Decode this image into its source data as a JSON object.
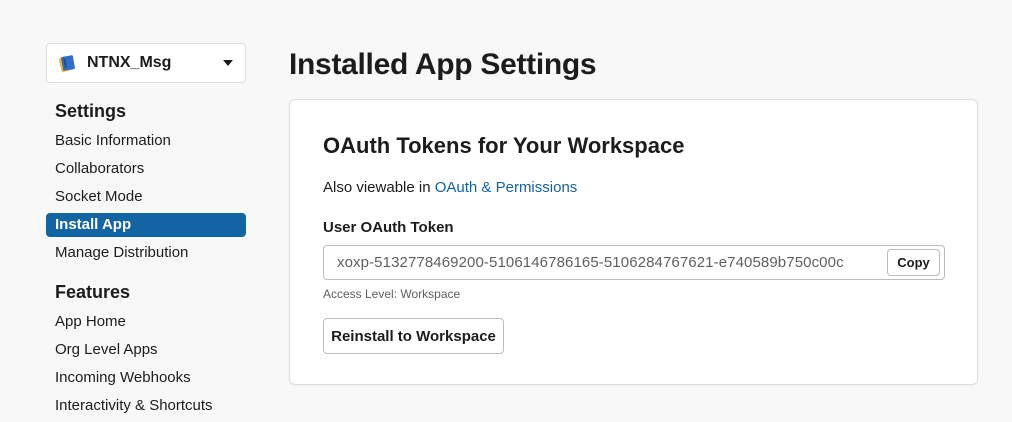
{
  "app_selector": {
    "app_name": "NTNX_Msg",
    "icon": "notebook-icon"
  },
  "sidebar": {
    "settings_heading": "Settings",
    "settings_items": [
      {
        "label": "Basic Information",
        "active": false
      },
      {
        "label": "Collaborators",
        "active": false
      },
      {
        "label": "Socket Mode",
        "active": false
      },
      {
        "label": "Install App",
        "active": true
      },
      {
        "label": "Manage Distribution",
        "active": false
      }
    ],
    "features_heading": "Features",
    "features_items": [
      {
        "label": "App Home"
      },
      {
        "label": "Org Level Apps"
      },
      {
        "label": "Incoming Webhooks"
      },
      {
        "label": "Interactivity & Shortcuts"
      }
    ]
  },
  "main": {
    "page_title": "Installed App Settings",
    "card": {
      "title": "OAuth Tokens for Your Workspace",
      "also_viewable_prefix": "Also viewable in ",
      "also_viewable_link": "OAuth & Permissions",
      "token_label": "User OAuth Token",
      "token_value": "xoxp-5132778469200-5106146786165-5106284767621-e740589b750c00c",
      "copy_label": "Copy",
      "access_level": "Access Level: Workspace",
      "reinstall_label": "Reinstall to Workspace"
    }
  },
  "colors": {
    "accent": "#1264a3",
    "background": "#f8f8f8",
    "text": "#1d1c1d"
  }
}
